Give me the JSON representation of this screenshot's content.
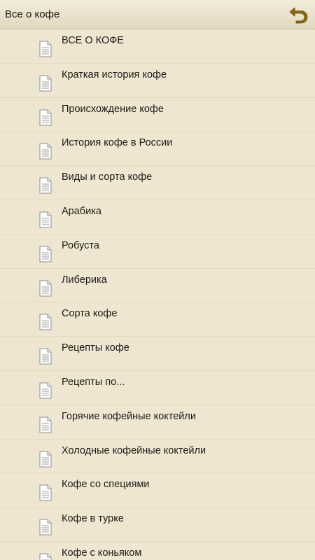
{
  "header": {
    "title": "Все о кофе",
    "back_icon": "back-arrow-icon",
    "accent_color": "#8a6a14"
  },
  "list": {
    "item_icon": "document-icon",
    "items": [
      {
        "label": "ВСЕ О КОФЕ"
      },
      {
        "label": "Краткая история кофе"
      },
      {
        "label": "Происхождение кофе"
      },
      {
        "label": "История кофе в России"
      },
      {
        "label": "Виды и сорта кофе"
      },
      {
        "label": "Арабика"
      },
      {
        "label": "Робуста"
      },
      {
        "label": "Либерика"
      },
      {
        "label": "Сорта кофе"
      },
      {
        "label": "Рецепты кофе"
      },
      {
        "label": "Рецепты по..."
      },
      {
        "label": "Горячие кофейные коктейли"
      },
      {
        "label": "Холодные кофейные коктейли"
      },
      {
        "label": "Кофе со специями"
      },
      {
        "label": "Кофе в турке"
      },
      {
        "label": "Кофе с коньяком"
      }
    ]
  }
}
